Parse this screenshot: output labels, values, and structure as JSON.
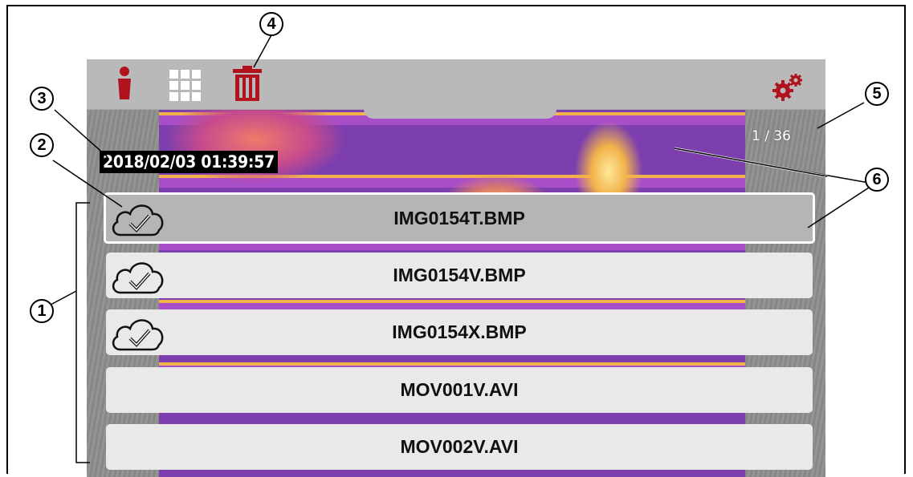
{
  "screen": {
    "counter": "1 / 36",
    "timestamp": "2018/02/03 01:39:57"
  },
  "toolbar": {
    "info_icon": "info-icon",
    "grid_icon": "grid-icon",
    "trash_icon": "trash-icon",
    "settings_icon": "gears-icon",
    "accent_color": "#b0131e"
  },
  "files": [
    {
      "name": "IMG0154T.BMP",
      "uploaded": true,
      "selected": true
    },
    {
      "name": "IMG0154V.BMP",
      "uploaded": true,
      "selected": false
    },
    {
      "name": "IMG0154X.BMP",
      "uploaded": true,
      "selected": false
    },
    {
      "name": "MOV001V.AVI",
      "uploaded": false,
      "selected": false
    },
    {
      "name": "MOV002V.AVI",
      "uploaded": false,
      "selected": false
    }
  ],
  "callouts": [
    "1",
    "2",
    "3",
    "4",
    "5",
    "6"
  ]
}
